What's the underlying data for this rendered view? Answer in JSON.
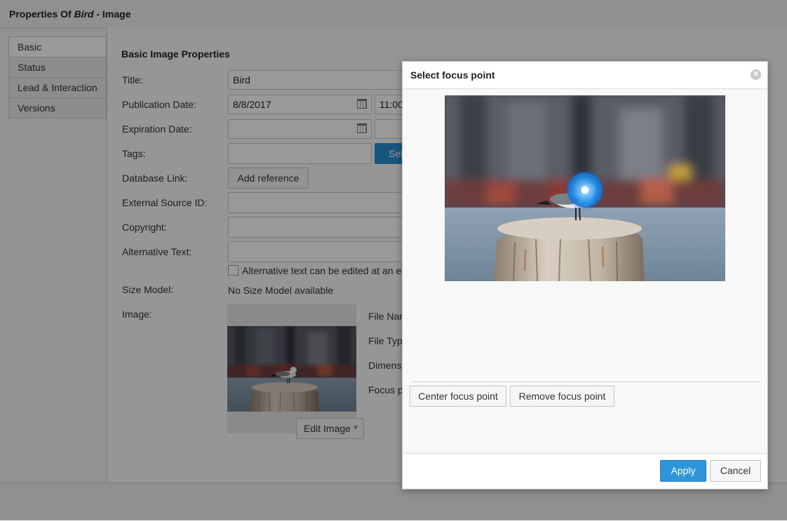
{
  "window": {
    "title_prefix": "Properties Of ",
    "title_item": "Bird",
    "title_suffix": " - Image"
  },
  "sidebar": {
    "items": [
      {
        "label": "Basic"
      },
      {
        "label": "Status"
      },
      {
        "label": "Lead & Interaction"
      },
      {
        "label": "Versions"
      }
    ]
  },
  "form": {
    "section_title": "Basic Image Properties",
    "title_label": "Title:",
    "title_value": "Bird",
    "pub_date_label": "Publication Date:",
    "pub_date_value": "8/8/2017",
    "pub_time_value": "11:00",
    "exp_date_label": "Expiration Date:",
    "tags_label": "Tags:",
    "tags_select_label": "Select",
    "db_link_label": "Database Link:",
    "add_reference_label": "Add reference",
    "ext_source_label": "External Source ID:",
    "copyright_label": "Copyright:",
    "alt_text_label": "Alternative Text:",
    "alt_text_checkbox_label": "Alternative text can be edited at an element",
    "size_model_label": "Size Model:",
    "size_model_value": "No Size Model available",
    "image_label": "Image:",
    "file_name_label": "File Name",
    "file_type_label": "File Type",
    "dimensions_label": "Dimensions",
    "focus_point_label": "Focus point",
    "edit_image_label": "Edit Image"
  },
  "dialog": {
    "title": "Select focus point",
    "center_focus_label": "Center focus point",
    "remove_focus_label": "Remove focus point",
    "apply_label": "Apply",
    "cancel_label": "Cancel",
    "accent_color": "#2f95d9"
  }
}
